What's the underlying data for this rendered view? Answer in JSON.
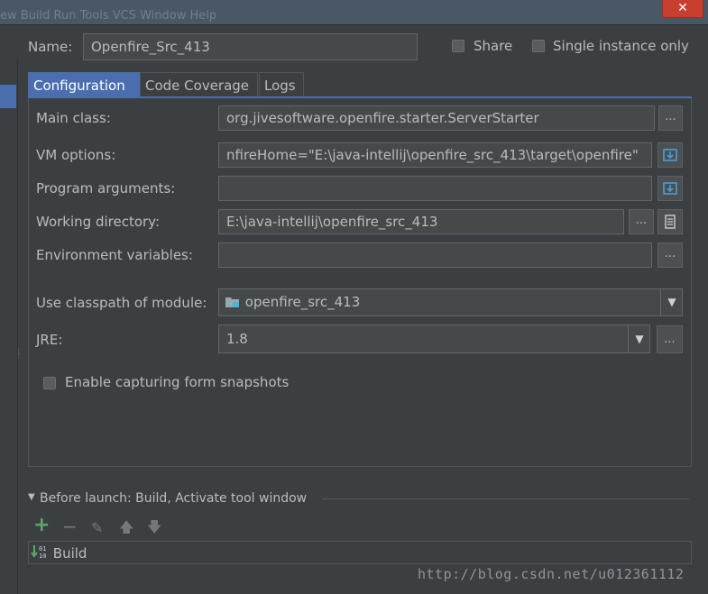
{
  "titlebar": {
    "menu_text": "ew Build Run Tools VCS Window Help",
    "close_glyph": "✕"
  },
  "form": {
    "name_label": "Name:",
    "name_value": "Openfire_Src_413",
    "share_label": "Share",
    "single_instance_label": "Single instance only"
  },
  "tabs": [
    {
      "label": "Configuration",
      "active": true
    },
    {
      "label": "Code Coverage",
      "active": false
    },
    {
      "label": "Logs",
      "active": false
    }
  ],
  "config": {
    "main_class_label": "Main class:",
    "main_class_value": "org.jivesoftware.openfire.starter.ServerStarter",
    "vm_options_label": "VM options:",
    "vm_options_value": "nfireHome=\"E:\\java-intellij\\openfire_src_413\\target\\openfire\"",
    "program_args_label": "Program arguments:",
    "program_args_value": "",
    "working_dir_label": "Working directory:",
    "working_dir_value": "E:\\java-intellij\\openfire_src_413",
    "env_vars_label": "Environment variables:",
    "env_vars_value": "",
    "classpath_label": "Use classpath of module:",
    "classpath_value": "openfire_src_413",
    "jre_label": "JRE:",
    "jre_value": "1.8",
    "snapshots_label": "Enable capturing form snapshots",
    "ellipsis": "..."
  },
  "before_launch": {
    "title": "Before launch: Build, Activate tool window",
    "items": [
      {
        "label": "Build"
      }
    ]
  },
  "watermark": "http://blog.csdn.net/u012361112",
  "colors": {
    "accent": "#4b6eaf",
    "background": "#3c3f41",
    "field": "#45494a",
    "add_green": "#59a869"
  }
}
